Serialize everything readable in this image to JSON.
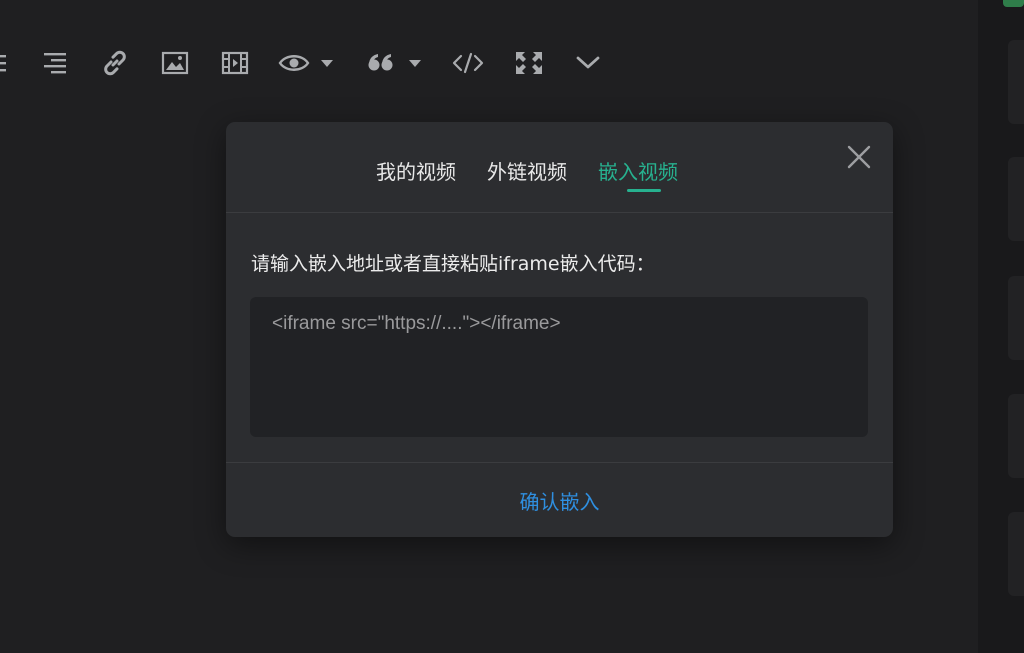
{
  "toolbar": {
    "items": [
      {
        "icon": "list-icon"
      },
      {
        "icon": "align-right-icon"
      },
      {
        "icon": "link-icon"
      },
      {
        "icon": "image-icon"
      },
      {
        "icon": "video-icon"
      },
      {
        "icon": "eye-icon",
        "dropdown": true
      },
      {
        "icon": "quote-icon",
        "dropdown": true
      },
      {
        "icon": "code-icon"
      },
      {
        "icon": "fullscreen-icon"
      },
      {
        "icon": "chevron-down-icon"
      }
    ],
    "icon_color": "#a9abae"
  },
  "dialog": {
    "tabs": [
      {
        "label": "我的视频",
        "active": false
      },
      {
        "label": "外链视频",
        "active": false
      },
      {
        "label": "嵌入视频",
        "active": true
      }
    ],
    "close_icon": "close-icon",
    "prompt": "请输入嵌入地址或者直接粘贴iframe嵌入代码：",
    "input": {
      "value": "",
      "placeholder": "<iframe src=\"https://....\"></iframe>"
    },
    "confirm_label": "确认嵌入"
  },
  "colors": {
    "background": "#1f1f21",
    "dialog_bg": "#2c2d30",
    "input_bg": "#212225",
    "accent_green": "#27b18f",
    "link_blue": "#2f8fe0",
    "status_green": "#2f7d4a"
  }
}
